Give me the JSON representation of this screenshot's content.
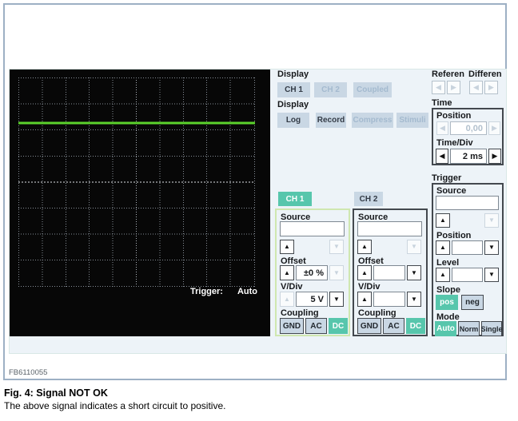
{
  "figure": {
    "code": "FB6110055",
    "caption_title": "Fig. 4: Signal NOT OK",
    "caption_text": "The above signal indicates a short circuit to positive."
  },
  "colors": {
    "accent_teal": "#57c6ac",
    "button_bg": "#c9d7e4",
    "disabled_text": "#a4bacf",
    "trace_green": "#5cd32d",
    "frame_border": "#9db0c4",
    "scope_bg": "#070707"
  },
  "scope": {
    "trigger_label": "Trigger:",
    "trigger_mode": "Auto",
    "trace": {
      "type": "flat-line",
      "color": "#5cd32d",
      "position_fraction_from_top": 0.22
    }
  },
  "display_channels": {
    "label": "Display",
    "ch1": "CH 1",
    "ch2": "CH 2",
    "coupled": "Coupled"
  },
  "display_modes": {
    "label": "Display",
    "log": "Log",
    "record": "Record",
    "compress": "Compress",
    "stimuli": "Stimuli"
  },
  "reference": {
    "label": "Referen"
  },
  "difference": {
    "label": "Differen"
  },
  "time": {
    "label": "Time",
    "position_label": "Position",
    "position_value": "0,00",
    "timediv_label": "Time/Div",
    "timediv_value": "2 ms"
  },
  "trigger": {
    "label": "Trigger",
    "source_label": "Source",
    "source_value": "",
    "position_label": "Position",
    "position_value": "",
    "level_label": "Level",
    "level_value": "",
    "slope_label": "Slope",
    "slope_pos": "pos",
    "slope_neg": "neg",
    "mode_label": "Mode",
    "mode_auto": "Auto",
    "mode_norm": "Norm",
    "mode_single": "Single"
  },
  "ch1": {
    "header": "CH 1",
    "source_label": "Source",
    "source_value": "",
    "offset_label": "Offset",
    "offset_value": "±0 %",
    "vdiv_label": "V/Div",
    "vdiv_value": "5 V",
    "coupling_label": "Coupling",
    "gnd": "GND",
    "ac": "AC",
    "dc": "DC"
  },
  "ch2": {
    "header": "CH 2",
    "source_label": "Source",
    "source_value": "",
    "offset_label": "Offset",
    "offset_value": "",
    "vdiv_label": "V/Div",
    "vdiv_value": "",
    "coupling_label": "Coupling",
    "gnd": "GND",
    "ac": "AC",
    "dc": "DC"
  }
}
